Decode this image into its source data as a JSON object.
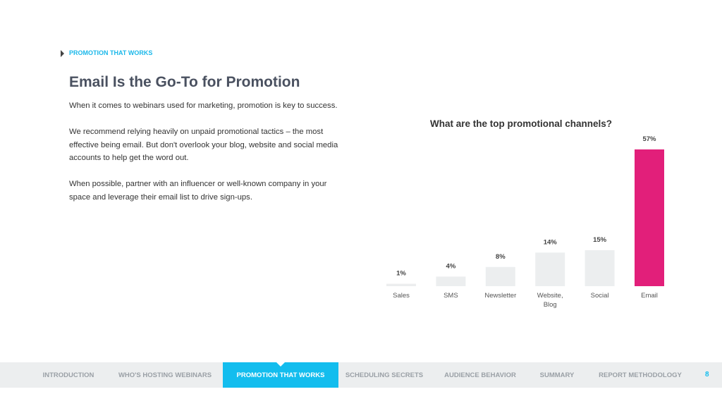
{
  "section_label": "PROMOTION THAT WORKS",
  "title": "Email Is the Go-To for Promotion",
  "paragraphs": [
    "When it comes to webinars used for marketing, promotion is key to success.",
    "We recommend relying heavily on unpaid promotional tactics – the most effective being email. But don't overlook your blog, website and social media accounts to help get the word out.",
    "When possible, partner with an influencer or well-known company in your space and leverage their email list to drive sign-ups."
  ],
  "chart_data": {
    "type": "bar",
    "title": "What are the top promotional channels?",
    "categories": [
      "Sales",
      "SMS",
      "Newsletter",
      "Website, Blog",
      "Social",
      "Email"
    ],
    "values": [
      1,
      4,
      8,
      14,
      15,
      57
    ],
    "data_labels": [
      "1%",
      "4%",
      "8%",
      "14%",
      "15%",
      "57%"
    ],
    "unit": "%",
    "ylim": [
      0,
      57
    ],
    "grid": false,
    "colors": {
      "default": "#eceeef",
      "highlight": "#e21f7a"
    },
    "highlight_category": "Email"
  },
  "nav": {
    "items": [
      "INTRODUCTION",
      "WHO'S HOSTING WEBINARS",
      "PROMOTION THAT WORKS",
      "SCHEDULING SECRETS",
      "AUDIENCE BEHAVIOR",
      "SUMMARY",
      "REPORT METHODOLOGY"
    ],
    "active_index": 2,
    "page_number": "8"
  }
}
